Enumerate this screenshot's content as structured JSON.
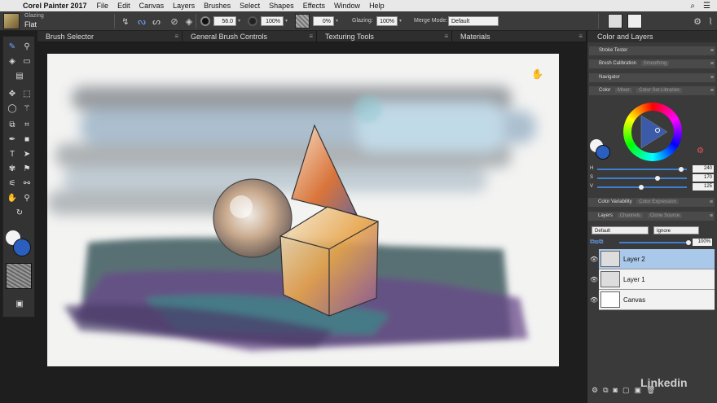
{
  "menubar": {
    "app_name": "Corel Painter 2017",
    "items": [
      "File",
      "Edit",
      "Canvas",
      "Layers",
      "Brushes",
      "Select",
      "Shapes",
      "Effects",
      "Window",
      "Help"
    ]
  },
  "property_bar": {
    "brush_category": "Glazing",
    "brush_variant": "Flat",
    "size_value": "56.0",
    "opacity_value": "100%",
    "grain_value": "0%",
    "glazing_label": "Glazing:",
    "glazing_value": "100%",
    "merge_mode_label": "Merge Mode:",
    "merge_mode_value": "Default"
  },
  "panels": {
    "brush_selector": "Brush Selector",
    "general_brush_controls": "General Brush Controls",
    "texturing_tools": "Texturing Tools",
    "materials": "Materials",
    "color_and_layers": "Color and Layers"
  },
  "right_panel": {
    "stroke_tester": "Stroke Tester",
    "brush_calibration": "Brush Calibration",
    "smoothing": "Smoothing",
    "navigator": "Navigator",
    "color_tab": "Color",
    "mixer_tab": "Mixer",
    "color_set_libraries_tab": "Color Set Libraries",
    "hsv": [
      {
        "label": "H",
        "value": "240",
        "fraction": 0.94
      },
      {
        "label": "S",
        "value": "170",
        "fraction": 0.67
      },
      {
        "label": "V",
        "value": "125",
        "fraction": 0.49
      }
    ],
    "color_variability_tab": "Color Variability",
    "color_expression_tab": "Color Expression",
    "layers_tab": "Layers",
    "channels_tab": "Channels",
    "clone_source_tab": "Clone Source",
    "composite_method": "Default",
    "composite_depth": "Ignore",
    "opacity": "100%",
    "layers": [
      {
        "name": "Layer 2",
        "selected": true
      },
      {
        "name": "Layer 1",
        "selected": false
      },
      {
        "name": "Canvas",
        "selected": false
      }
    ]
  },
  "colors": {
    "main_color": "#2b5fbf",
    "selected_layer": "#a9c8ea"
  },
  "watermark": "Linkedin"
}
